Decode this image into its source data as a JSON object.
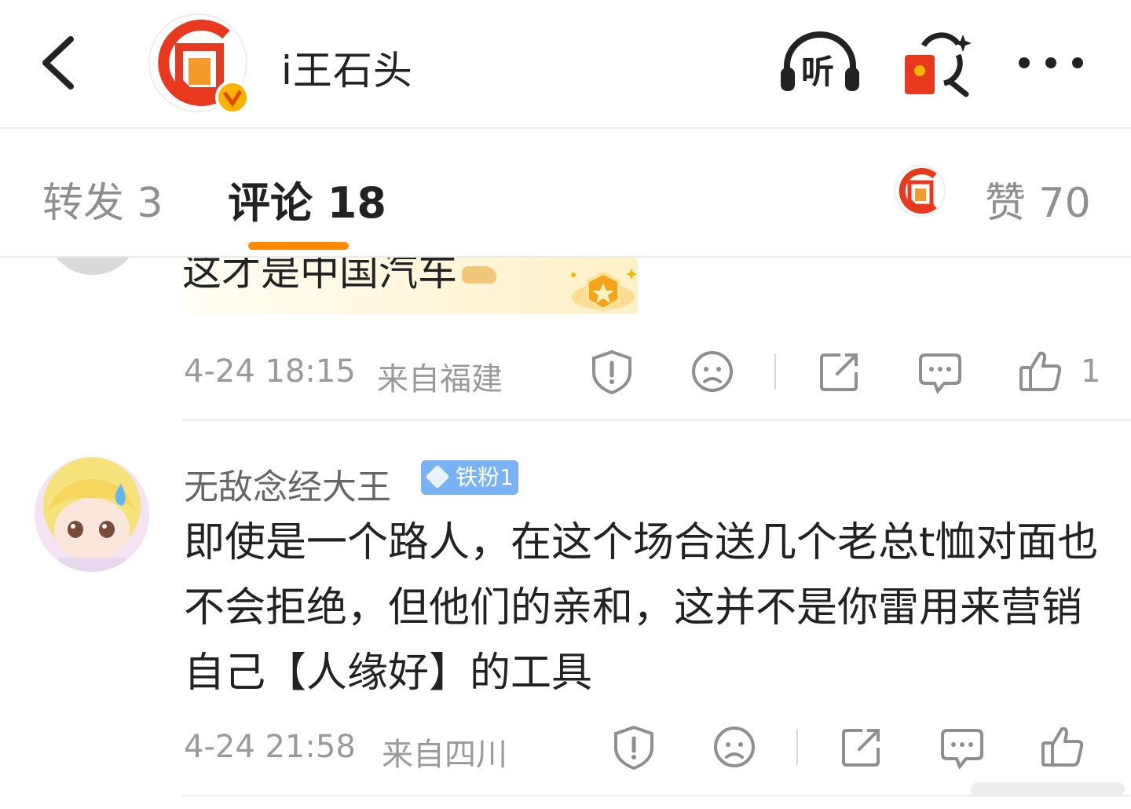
{
  "header": {
    "user_name": "i王石头",
    "listen_label": "听",
    "brand_color": "#e8381e",
    "accent_color": "#ff8a00"
  },
  "tabs": {
    "repost_label": "转发 3",
    "comments_label": "评论 18",
    "likes_label": "赞 70"
  },
  "comments": [
    {
      "text_visible": "这才是中国汽车",
      "time": "4-24 18:15",
      "location": "来自福建",
      "like_count": "1"
    },
    {
      "user_name": "无敌念经大王",
      "fan_badge": "铁粉1",
      "text": "即使是一个路人，在这个场合送几个老总t恤对面也不会拒绝，但他们的亲和，这并不是你雷用来营销自己【人缘好】的工具",
      "time": "4-24 21:58",
      "location": "来自四川"
    }
  ],
  "icons": [
    "back-icon",
    "headphones-icon",
    "red-packet-icon",
    "more-icon",
    "report-icon",
    "dislike-icon",
    "share-icon",
    "reply-icon",
    "like-icon"
  ]
}
